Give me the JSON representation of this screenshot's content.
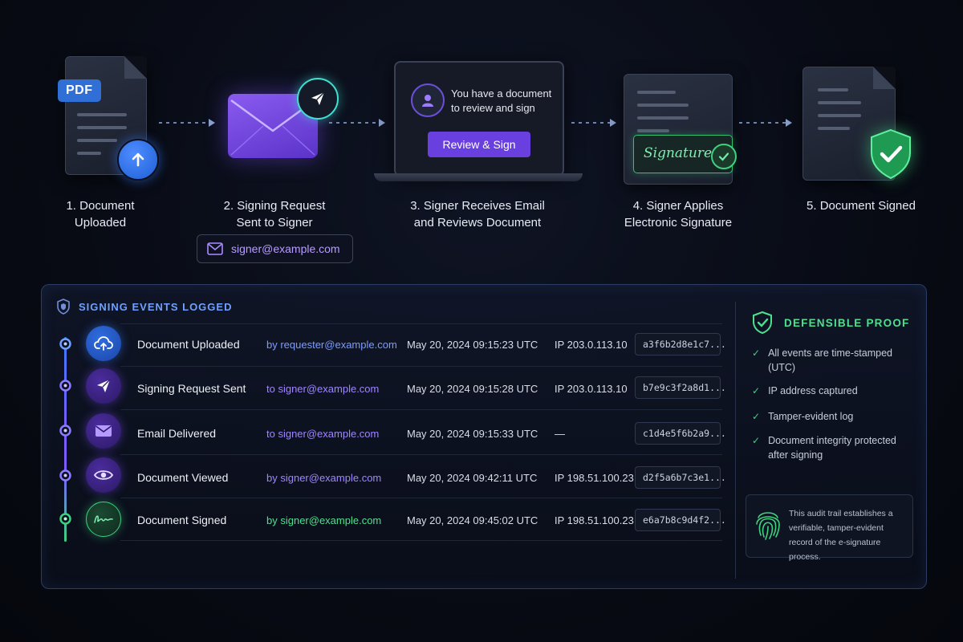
{
  "steps": [
    {
      "label": "1. Document\nUploaded"
    },
    {
      "label": "2. Signing Request\nSent to Signer"
    },
    {
      "label": "3. Signer Receives Email\nand Reviews Document"
    },
    {
      "label": "4. Signer Applies\nElectronic Signature"
    },
    {
      "label": "5. Document Signed"
    }
  ],
  "pdf_badge": "PDF",
  "email_chip": "signer@example.com",
  "laptop": {
    "notification": "You have a document\nto review and sign",
    "button": "Review & Sign"
  },
  "signature_text": "Signature",
  "events_panel": {
    "title": "SIGNING EVENTS LOGGED",
    "rows": [
      {
        "event": "Document Uploaded",
        "actor": "by requester@example.com",
        "time": "May 20, 2024 09:15:23 UTC",
        "ip": "IP 203.0.113.10",
        "hash": "a3f6b2d8e1c7...",
        "icon": "cloud-upload-icon",
        "color": "#3a7bff"
      },
      {
        "event": "Signing Request Sent",
        "actor": "to signer@example.com",
        "time": "May 20, 2024 09:15:28 UTC",
        "ip": "IP 203.0.113.10",
        "hash": "b7e9c3f2a8d1...",
        "icon": "send-icon",
        "color": "#8a5cff"
      },
      {
        "event": "Email Delivered",
        "actor": "to signer@example.com",
        "time": "May 20, 2024 09:15:33 UTC",
        "ip": "—",
        "hash": "c1d4e5f6b2a9...",
        "icon": "envelope-icon",
        "color": "#8a5cff"
      },
      {
        "event": "Document Viewed",
        "actor": "by signer@example.com",
        "time": "May 20, 2024 09:42:11 UTC",
        "ip": "IP 198.51.100.23",
        "hash": "d2f5a6b7c3e1...",
        "icon": "eye-icon",
        "color": "#8a5cff"
      },
      {
        "event": "Document Signed",
        "actor": "by signer@example.com",
        "time": "May 20, 2024 09:45:02 UTC",
        "ip": "IP 198.51.100.23",
        "hash": "e6a7b8c9d4f2...",
        "icon": "signature-icon",
        "color": "#3dd27f"
      }
    ]
  },
  "proof": {
    "title": "DEFENSIBLE PROOF",
    "items": [
      "All events are time-stamped (UTC)",
      "IP address captured",
      "Tamper-evident log",
      "Document integrity protected after signing"
    ],
    "note": "This audit trail establishes a verifiable, tamper-evident record of the e-signature process."
  },
  "colors": {
    "accent_blue": "#3a7bff",
    "accent_purple": "#7c4dff",
    "accent_green": "#3dd27f"
  }
}
